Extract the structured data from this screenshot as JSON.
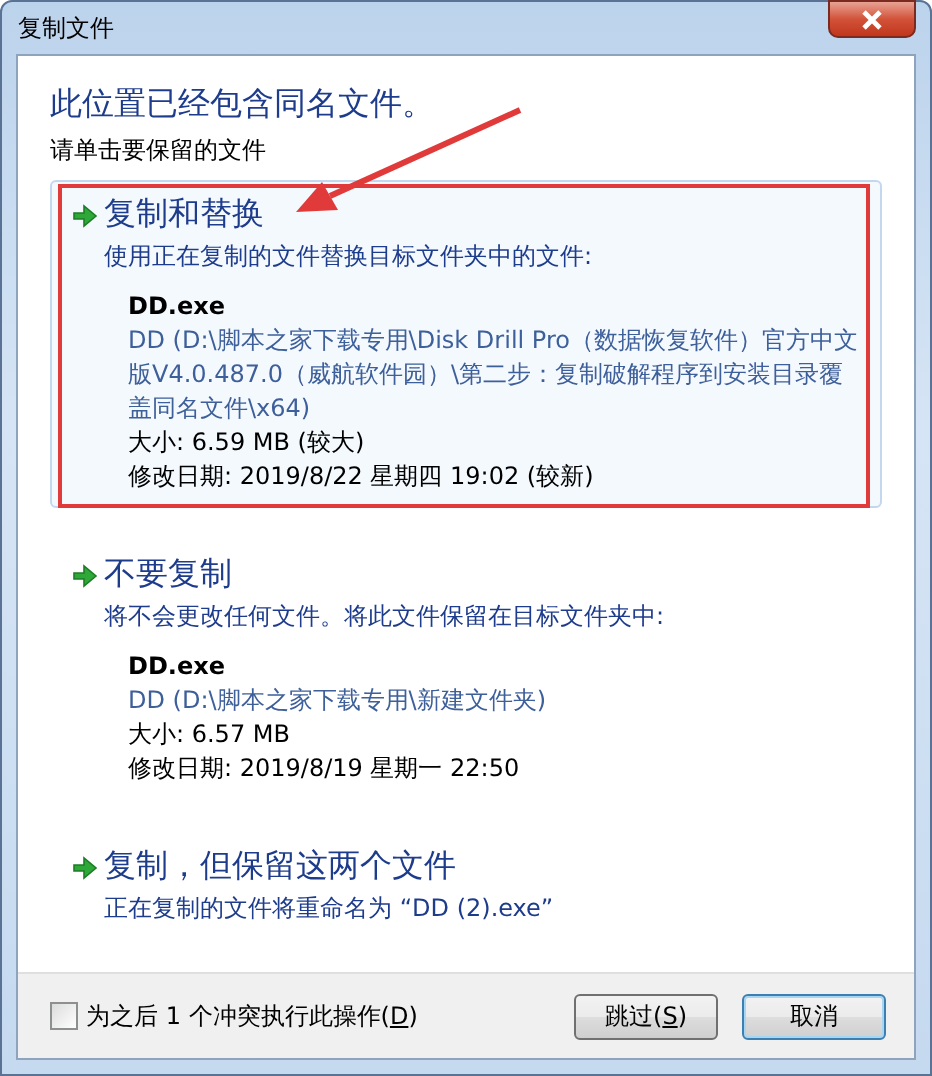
{
  "window": {
    "title": "复制文件"
  },
  "heading": "此位置已经包含同名文件。",
  "instruction": "请单击要保留的文件",
  "options": [
    {
      "title": "复制和替换",
      "description": "使用正在复制的文件替换目标文件夹中的文件:",
      "selected": true,
      "file": {
        "name": "DD.exe",
        "location": "DD (D:\\脚本之家下载专用\\Disk Drill Pro（数据恢复软件）官方中文版V4.0.487.0（威航软件园）\\第二步：复制破解程序到安装目录覆盖同名文件\\x64)",
        "size": "大小: 6.59 MB (较大)",
        "modified": "修改日期: 2019/8/22 星期四 19:02 (较新)"
      }
    },
    {
      "title": "不要复制",
      "description": "将不会更改任何文件。将此文件保留在目标文件夹中:",
      "selected": false,
      "file": {
        "name": "DD.exe",
        "location": "DD (D:\\脚本之家下载专用\\新建文件夹)",
        "size": "大小: 6.57 MB",
        "modified": "修改日期: 2019/8/19 星期一 22:50"
      }
    },
    {
      "title": "复制，但保留这两个文件",
      "description": "正在复制的文件将重命名为 “DD (2).exe”",
      "selected": false
    }
  ],
  "apply_to_all": {
    "label_before": "为之后 1 个冲突执行此操作(",
    "access_key": "D",
    "label_after": ")",
    "checked": false
  },
  "buttons": [
    {
      "label_before": "跳过(",
      "access_key": "S",
      "label_after": ")",
      "focused": false
    },
    {
      "label_before": "取消",
      "focused": true
    }
  ]
}
